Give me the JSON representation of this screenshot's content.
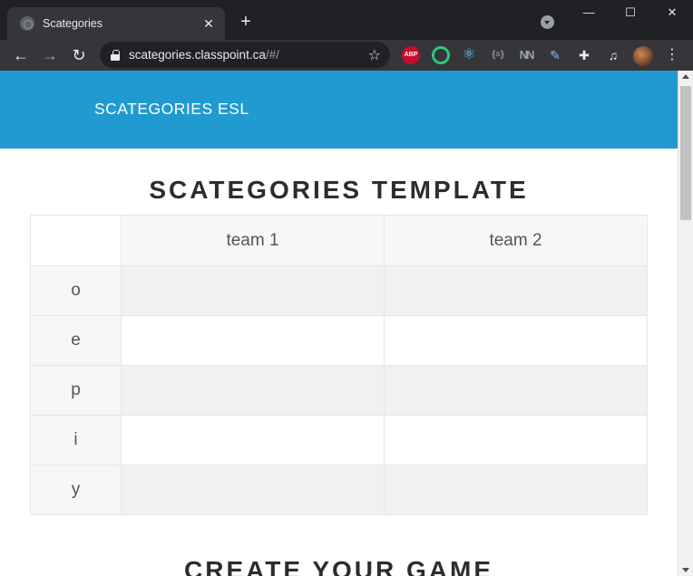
{
  "browser": {
    "tab_title": "Scategories",
    "tab_close": "✕",
    "new_tab": "+",
    "url_host": "scategories.classpoint.ca",
    "url_path": "/#/",
    "window_controls": {
      "minimize": "—",
      "maximize": "☐",
      "close": "✕"
    },
    "extensions": {
      "abp": "ABP",
      "json": "{≡}",
      "nn": "NN"
    }
  },
  "site": {
    "brand": "SCATEGORIES ESL",
    "page_title": "SCATEGORIES TEMPLATE",
    "next_section_title": "CREATE YOUR GAME"
  },
  "table": {
    "columns": [
      "team 1",
      "team 2"
    ],
    "rows": [
      {
        "letter": "o",
        "team1": "",
        "team2": ""
      },
      {
        "letter": "e",
        "team1": "",
        "team2": ""
      },
      {
        "letter": "p",
        "team1": "",
        "team2": ""
      },
      {
        "letter": "i",
        "team1": "",
        "team2": ""
      },
      {
        "letter": "y",
        "team1": "",
        "team2": ""
      }
    ]
  },
  "colors": {
    "header_blue": "#209ad0",
    "row_alt": "#f1f1f1",
    "letter_cell": "#f7f7f9"
  }
}
